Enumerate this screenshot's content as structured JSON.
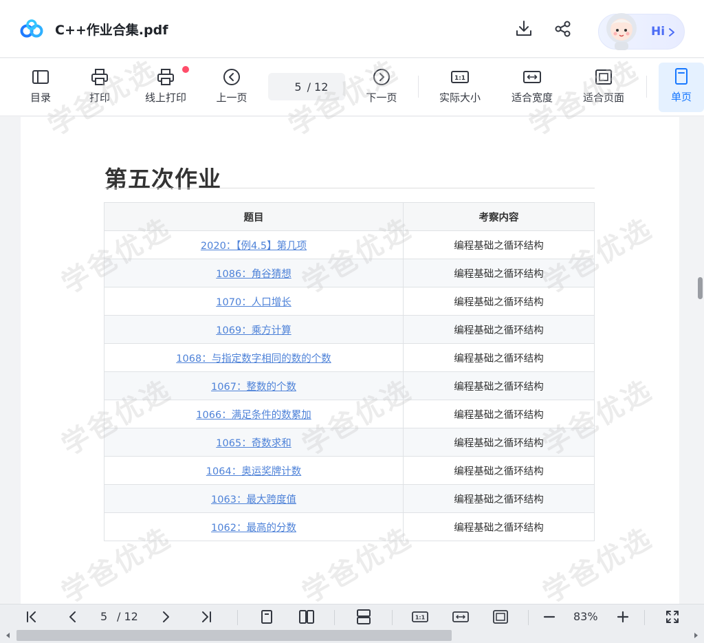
{
  "header": {
    "title": "C++作业合集.pdf",
    "hi_label": "Hi"
  },
  "toolbar": {
    "items": [
      {
        "label": "目录"
      },
      {
        "label": "打印"
      },
      {
        "label": "线上打印"
      },
      {
        "label": "上一页"
      },
      {
        "label": "下一页"
      },
      {
        "label": "实际大小"
      },
      {
        "label": "适合宽度"
      },
      {
        "label": "适合页面"
      },
      {
        "label": "单页"
      }
    ],
    "page_current": "5",
    "page_total": "/ 12",
    "actual_size_badge": "1:1"
  },
  "document": {
    "heading": "第五次作业",
    "table": {
      "headers": [
        "题目",
        "考察内容"
      ],
      "rows": [
        {
          "title": "2020：【例4.5】第几项",
          "topic": "编程基础之循环结构"
        },
        {
          "title": "1086：角谷猜想",
          "topic": "编程基础之循环结构"
        },
        {
          "title": "1070：人口增长",
          "topic": "编程基础之循环结构"
        },
        {
          "title": "1069：乘方计算",
          "topic": "编程基础之循环结构"
        },
        {
          "title": "1068：与指定数字相同的数的个数",
          "topic": "编程基础之循环结构"
        },
        {
          "title": "1067：整数的个数",
          "topic": "编程基础之循环结构"
        },
        {
          "title": "1066：满足条件的数累加",
          "topic": "编程基础之循环结构"
        },
        {
          "title": "1065：奇数求和",
          "topic": "编程基础之循环结构"
        },
        {
          "title": "1064：奥运奖牌计数",
          "topic": "编程基础之循环结构"
        },
        {
          "title": "1063：最大跨度值",
          "topic": "编程基础之循环结构"
        },
        {
          "title": "1062：最高的分数",
          "topic": "编程基础之循环结构"
        }
      ]
    },
    "watermark": "学爸优选"
  },
  "bottombar": {
    "page_current": "5",
    "page_total": "/ 12",
    "zoom": "83%",
    "actual_size_badge": "1:1"
  },
  "colors": {
    "accent": "#1677ff",
    "link": "#4e82d8",
    "notification_dot": "#ff4d6a"
  }
}
